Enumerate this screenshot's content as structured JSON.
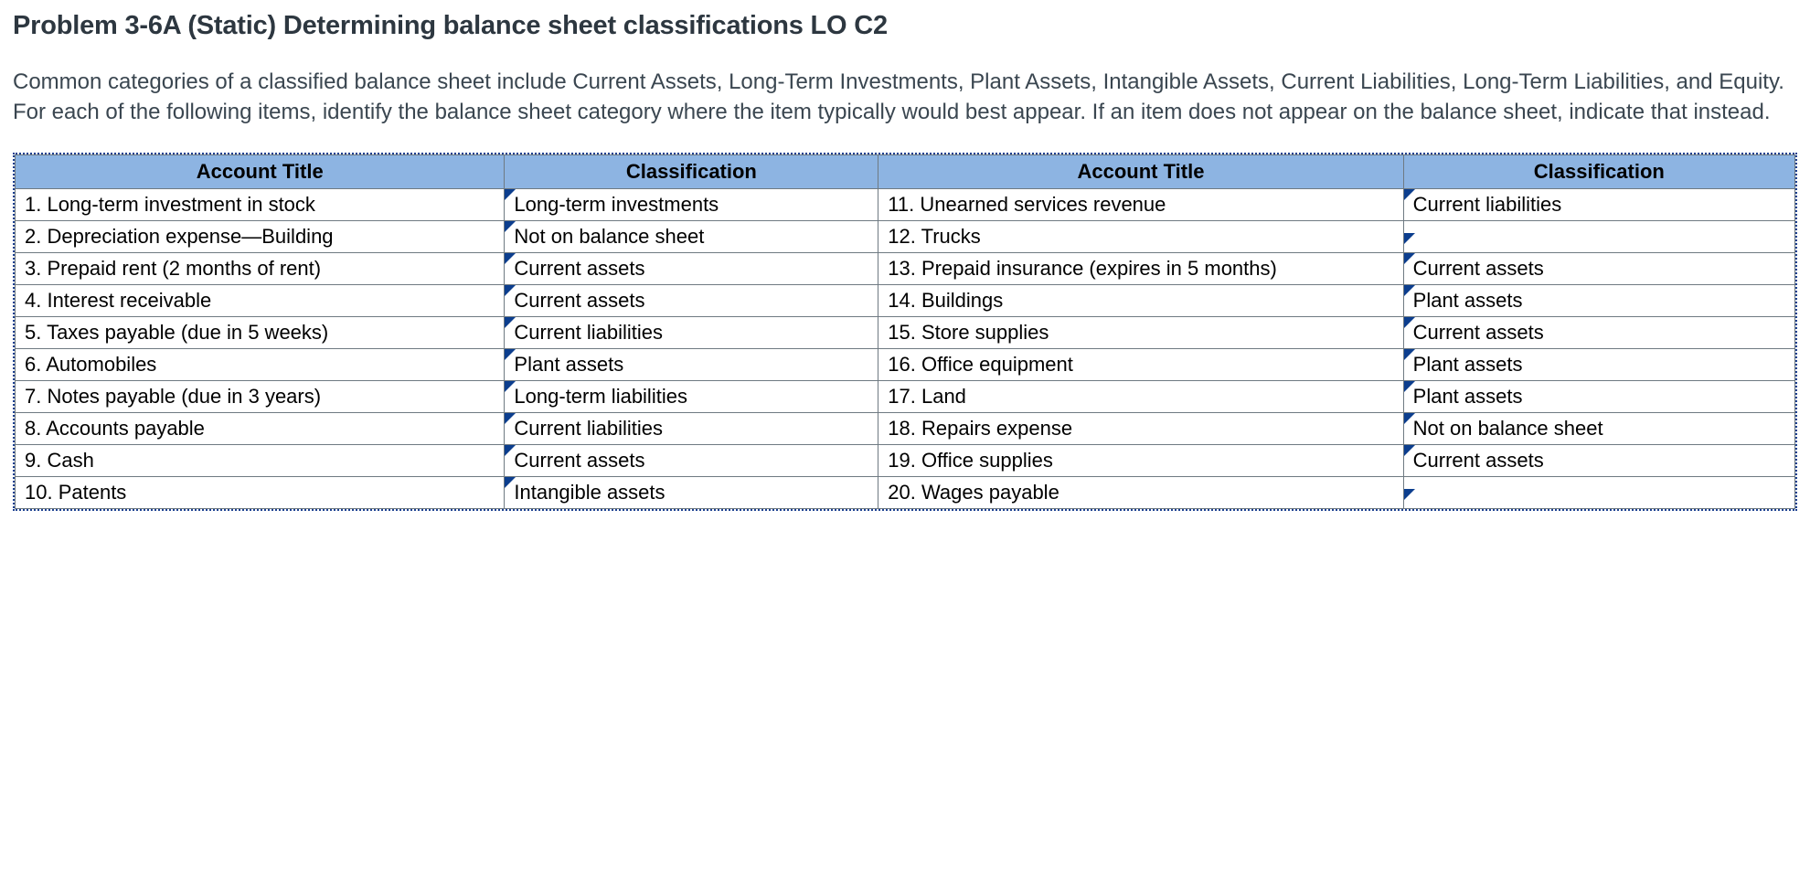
{
  "title": "Problem 3-6A (Static) Determining balance sheet classifications LO C2",
  "instructions": "Common categories of a classified balance sheet include Current Assets, Long-Term Investments, Plant Assets, Intangible Assets, Current Liabilities, Long-Term Liabilities, and Equity. For each of the following items, identify the balance sheet category where the item typically would best appear. If an item does not appear on the balance sheet, indicate that instead.",
  "headers": {
    "account_title": "Account Title",
    "classification": "Classification"
  },
  "rows_left": [
    {
      "account": "1. Long-term investment in stock",
      "classification": "Long-term investments"
    },
    {
      "account": "2. Depreciation expense—Building",
      "classification": "Not on balance sheet"
    },
    {
      "account": "3. Prepaid rent (2 months of rent)",
      "classification": "Current assets"
    },
    {
      "account": "4. Interest receivable",
      "classification": "Current assets"
    },
    {
      "account": "5. Taxes payable (due in 5 weeks)",
      "classification": "Current liabilities"
    },
    {
      "account": "6. Automobiles",
      "classification": "Plant assets"
    },
    {
      "account": "7. Notes payable (due in 3 years)",
      "classification": "Long-term liabilities"
    },
    {
      "account": "8. Accounts payable",
      "classification": "Current liabilities"
    },
    {
      "account": "9. Cash",
      "classification": "Current assets"
    },
    {
      "account": "10. Patents",
      "classification": "Intangible assets"
    }
  ],
  "rows_right": [
    {
      "account": "11. Unearned services revenue",
      "classification": "Current liabilities"
    },
    {
      "account": "12. Trucks",
      "classification": ""
    },
    {
      "account": "13. Prepaid insurance (expires in 5 months)",
      "classification": "Current assets"
    },
    {
      "account": "14. Buildings",
      "classification": "Plant assets"
    },
    {
      "account": "15. Store supplies",
      "classification": "Current assets"
    },
    {
      "account": "16. Office equipment",
      "classification": "Plant assets"
    },
    {
      "account": "17. Land",
      "classification": "Plant assets"
    },
    {
      "account": "18. Repairs expense",
      "classification": "Not on balance sheet"
    },
    {
      "account": "19. Office supplies",
      "classification": "Current assets"
    },
    {
      "account": "20. Wages payable",
      "classification": ""
    }
  ]
}
